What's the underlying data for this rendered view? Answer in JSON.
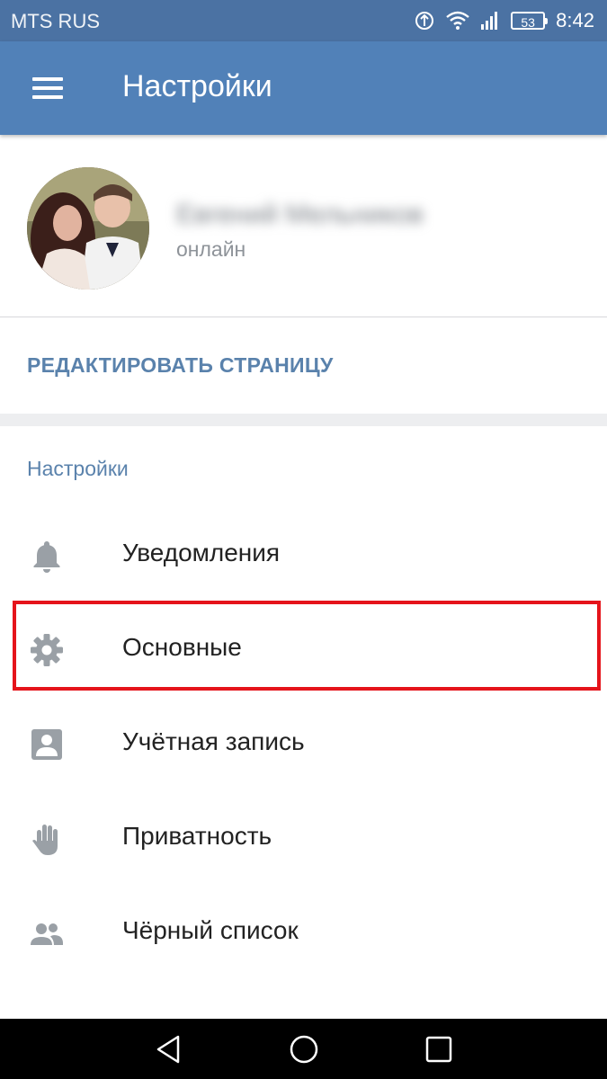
{
  "status_bar": {
    "carrier": "MTS RUS",
    "battery": "53",
    "time": "8:42",
    "icons": [
      "data-saver-icon",
      "wifi-icon",
      "signal-icon",
      "battery-icon"
    ]
  },
  "toolbar": {
    "title": "Настройки",
    "menu_icon": "hamburger-icon",
    "background": "#5181b8"
  },
  "profile": {
    "name": "Евгений Мельников",
    "status": "онлайн"
  },
  "edit_page": "РЕДАКТИРОВАТЬ СТРАНИЦУ",
  "settings_section": {
    "title": "Настройки",
    "items": [
      {
        "label": "Уведомления",
        "icon": "bell-icon"
      },
      {
        "label": "Основные",
        "icon": "gear-icon",
        "highlighted": true
      },
      {
        "label": "Учётная запись",
        "icon": "account-card-icon"
      },
      {
        "label": "Приватность",
        "icon": "hand-icon"
      },
      {
        "label": "Чёрный список",
        "icon": "people-icon"
      }
    ]
  },
  "colors": {
    "accent": "#5a82ac",
    "highlight_border": "#e5141b",
    "icon_gray": "#9aa0a6"
  },
  "nav_bar": {
    "buttons": [
      "back-icon",
      "home-icon",
      "recents-icon"
    ]
  }
}
